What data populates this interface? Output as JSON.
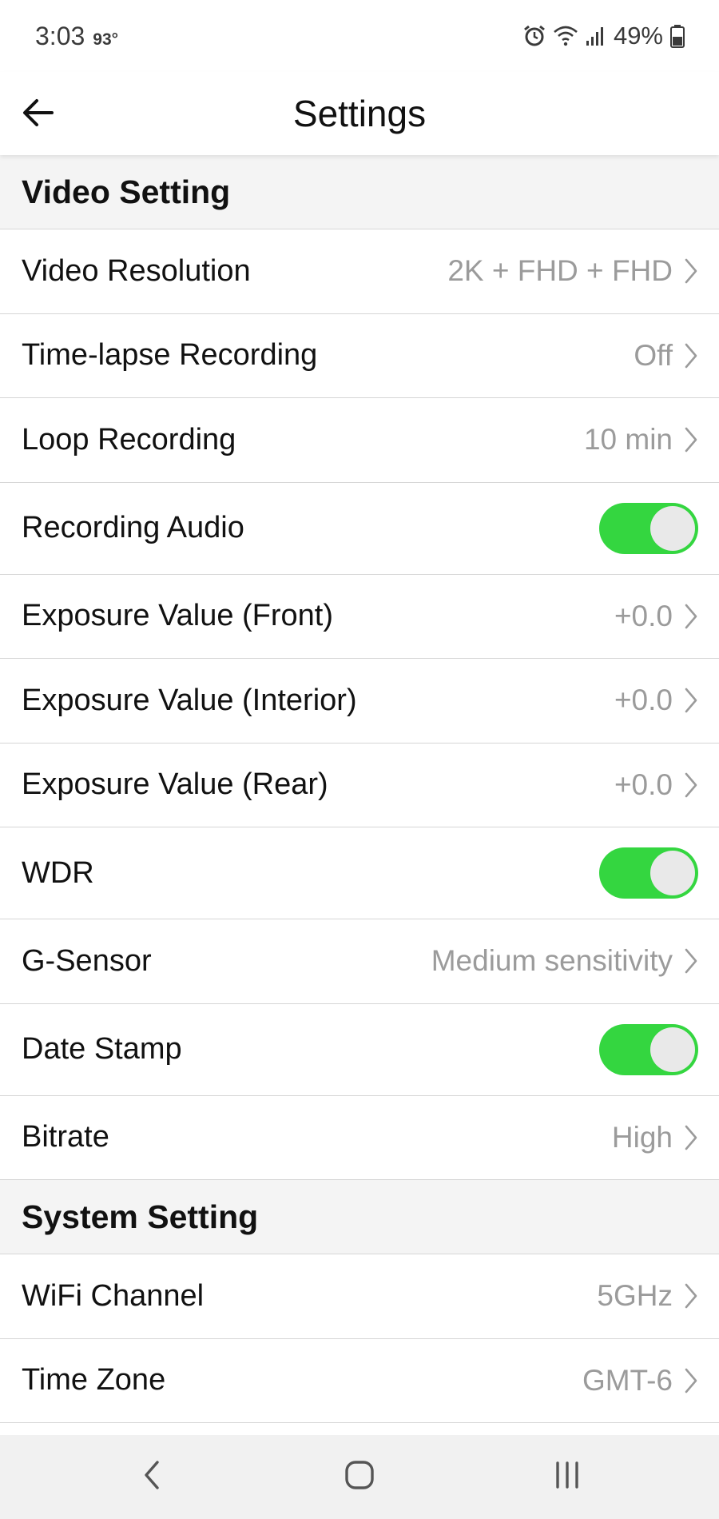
{
  "status_bar": {
    "time": "3:03",
    "temperature": "93°",
    "battery": "49%"
  },
  "header": {
    "title": "Settings"
  },
  "colors": {
    "accent_toggle": "#34d640",
    "value_text": "#9b9b9b",
    "section_bg": "#f4f4f4"
  },
  "icons": {
    "back": "arrow-left-icon",
    "chevron": "chevron-right-icon",
    "alarm": "alarm-icon",
    "wifi": "wifi-icon",
    "signal": "signal-icon",
    "battery": "battery-icon"
  },
  "sections": {
    "video": {
      "title": "Video Setting",
      "rows": [
        {
          "label": "Video Resolution",
          "value": "2K + FHD + FHD"
        },
        {
          "label": "Time-lapse Recording",
          "value": "Off"
        },
        {
          "label": "Loop Recording",
          "value": "10 min"
        },
        {
          "label": "Recording Audio",
          "on": true
        },
        {
          "label": "Exposure Value (Front)",
          "value": "+0.0"
        },
        {
          "label": "Exposure Value (Interior)",
          "value": "+0.0"
        },
        {
          "label": "Exposure Value (Rear)",
          "value": "+0.0"
        },
        {
          "label": "WDR",
          "on": true
        },
        {
          "label": "G-Sensor",
          "value": "Medium sensitivity"
        },
        {
          "label": "Date Stamp",
          "on": true
        },
        {
          "label": "Bitrate",
          "value": "High"
        }
      ]
    },
    "system": {
      "title": "System Setting",
      "rows": [
        {
          "label": "WiFi Channel",
          "value": "5GHz"
        },
        {
          "label": "Time Zone",
          "value": "GMT-6"
        }
      ]
    }
  },
  "bottom_nav": {
    "back": "nav-back-icon",
    "home": "nav-home-icon",
    "recents": "nav-recents-icon"
  }
}
